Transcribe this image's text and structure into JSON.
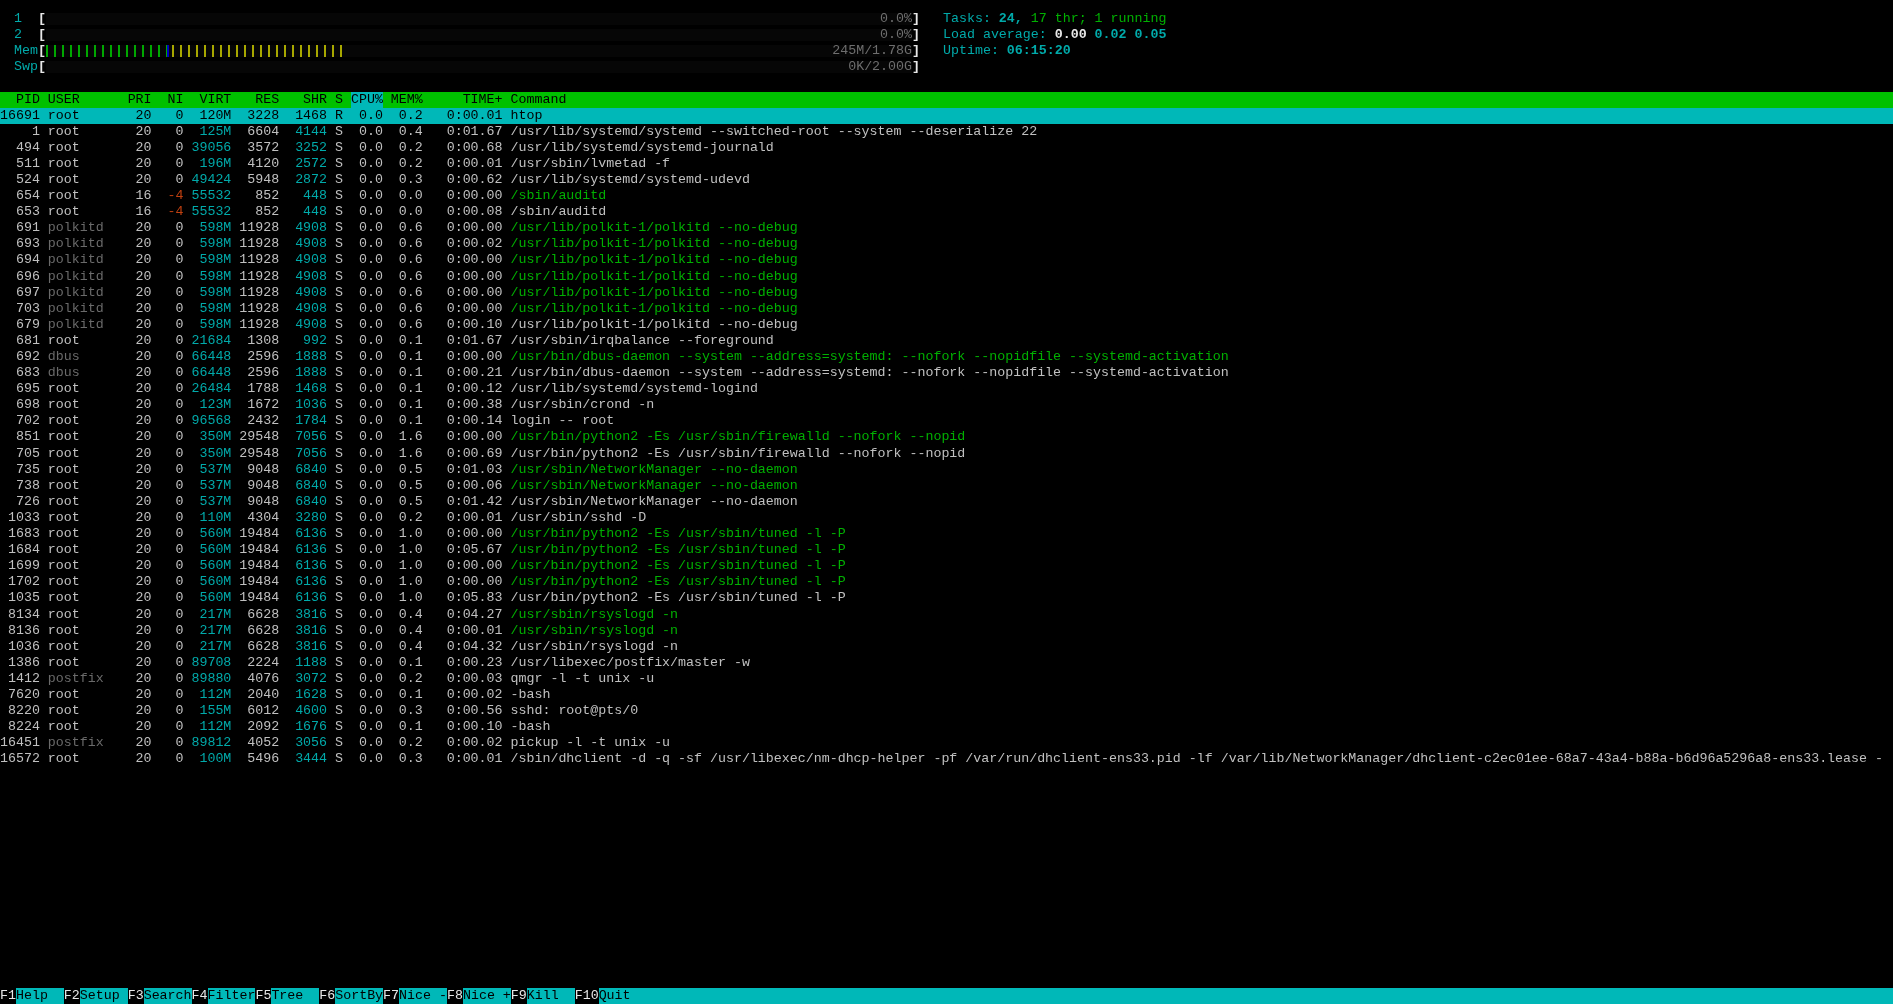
{
  "meters": [
    {
      "label": "1",
      "open": "[",
      "reading": "0.0%",
      "close": "]"
    },
    {
      "label": "2",
      "open": "[",
      "reading": "0.0%",
      "close": "]"
    },
    {
      "label": "Mem",
      "open": "[",
      "segments": [
        {
          "kind": "used",
          "level": 0.14
        },
        {
          "kind": "buffers",
          "level": 0.006
        },
        {
          "kind": "cache",
          "level": 0.2
        }
      ],
      "reading": "245M/1.78G",
      "close": "]"
    },
    {
      "label": "Swp",
      "open": "[",
      "reading": "0K/2.00G",
      "close": "]"
    }
  ],
  "summary": [
    [
      {
        "kind": "label",
        "text": "Tasks:"
      },
      {
        "kind": "value",
        "text": "24,"
      },
      {
        "kind": "thread",
        "text": "17"
      },
      {
        "kind": "thread",
        "text": "thr;"
      },
      {
        "kind": "thread",
        "text": "1"
      },
      {
        "kind": "thread",
        "text": "running"
      }
    ],
    [
      {
        "kind": "label",
        "text": "Load average:"
      },
      {
        "kind": "bright",
        "text": "0.00"
      },
      {
        "kind": "value",
        "text": "0.02"
      },
      {
        "kind": "value",
        "text": "0.05"
      }
    ],
    [
      {
        "kind": "label",
        "text": "Uptime:"
      },
      {
        "kind": "value",
        "text": "06:15:20"
      }
    ]
  ],
  "columns": [
    {
      "label": "PID",
      "sorted": false
    },
    {
      "label": "USER",
      "sorted": false
    },
    {
      "label": "PRI",
      "sorted": false
    },
    {
      "label": "NI",
      "sorted": false
    },
    {
      "label": "VIRT",
      "sorted": false
    },
    {
      "label": "RES",
      "sorted": false
    },
    {
      "label": "SHR",
      "sorted": false
    },
    {
      "label": "S",
      "sorted": false
    },
    {
      "label": "CPU%",
      "sorted": true
    },
    {
      "label": "MEM%",
      "sorted": false
    },
    {
      "label": "TIME+",
      "sorted": false
    },
    {
      "label": "Command",
      "sorted": false
    }
  ],
  "rows": [
    {
      "cells": [
        "16691",
        "root",
        "20",
        "0",
        "120M",
        "3228",
        "1468",
        "R",
        "0.0",
        "0.2",
        "0:00.01",
        "htop"
      ],
      "selected": true
    },
    {
      "cells": [
        "1",
        "root",
        "20",
        "0",
        "125M",
        "6604",
        "4144",
        "S",
        "0.0",
        "0.4",
        "0:01.67",
        "/usr/lib/systemd/systemd --switched-root --system --deserialize 22"
      ],
      "selected": false,
      "thread": false,
      "system_user": false,
      "niced": false
    },
    {
      "cells": [
        "494",
        "root",
        "20",
        "0",
        "39056",
        "3572",
        "3252",
        "S",
        "0.0",
        "0.2",
        "0:00.68",
        "/usr/lib/systemd/systemd-journald"
      ],
      "selected": false,
      "thread": false,
      "system_user": false,
      "niced": false
    },
    {
      "cells": [
        "511",
        "root",
        "20",
        "0",
        "196M",
        "4120",
        "2572",
        "S",
        "0.0",
        "0.2",
        "0:00.01",
        "/usr/sbin/lvmetad -f"
      ],
      "selected": false,
      "thread": false,
      "system_user": false,
      "niced": false
    },
    {
      "cells": [
        "524",
        "root",
        "20",
        "0",
        "49424",
        "5948",
        "2872",
        "S",
        "0.0",
        "0.3",
        "0:00.62",
        "/usr/lib/systemd/systemd-udevd"
      ],
      "selected": false,
      "thread": false,
      "system_user": false,
      "niced": false
    },
    {
      "cells": [
        "654",
        "root",
        "16",
        "-4",
        "55532",
        "852",
        "448",
        "S",
        "0.0",
        "0.0",
        "0:00.00",
        "/sbin/auditd"
      ],
      "selected": false,
      "thread": true,
      "system_user": false,
      "niced": true
    },
    {
      "cells": [
        "653",
        "root",
        "16",
        "-4",
        "55532",
        "852",
        "448",
        "S",
        "0.0",
        "0.0",
        "0:00.08",
        "/sbin/auditd"
      ],
      "selected": false,
      "thread": false,
      "system_user": false,
      "niced": true
    },
    {
      "cells": [
        "691",
        "polkitd",
        "20",
        "0",
        "598M",
        "11928",
        "4908",
        "S",
        "0.0",
        "0.6",
        "0:00.00",
        "/usr/lib/polkit-1/polkitd --no-debug"
      ],
      "selected": false,
      "thread": true,
      "system_user": true,
      "niced": false
    },
    {
      "cells": [
        "693",
        "polkitd",
        "20",
        "0",
        "598M",
        "11928",
        "4908",
        "S",
        "0.0",
        "0.6",
        "0:00.02",
        "/usr/lib/polkit-1/polkitd --no-debug"
      ],
      "selected": false,
      "thread": true,
      "system_user": true,
      "niced": false
    },
    {
      "cells": [
        "694",
        "polkitd",
        "20",
        "0",
        "598M",
        "11928",
        "4908",
        "S",
        "0.0",
        "0.6",
        "0:00.00",
        "/usr/lib/polkit-1/polkitd --no-debug"
      ],
      "selected": false,
      "thread": true,
      "system_user": true,
      "niced": false
    },
    {
      "cells": [
        "696",
        "polkitd",
        "20",
        "0",
        "598M",
        "11928",
        "4908",
        "S",
        "0.0",
        "0.6",
        "0:00.00",
        "/usr/lib/polkit-1/polkitd --no-debug"
      ],
      "selected": false,
      "thread": true,
      "system_user": true,
      "niced": false
    },
    {
      "cells": [
        "697",
        "polkitd",
        "20",
        "0",
        "598M",
        "11928",
        "4908",
        "S",
        "0.0",
        "0.6",
        "0:00.00",
        "/usr/lib/polkit-1/polkitd --no-debug"
      ],
      "selected": false,
      "thread": true,
      "system_user": true,
      "niced": false
    },
    {
      "cells": [
        "703",
        "polkitd",
        "20",
        "0",
        "598M",
        "11928",
        "4908",
        "S",
        "0.0",
        "0.6",
        "0:00.00",
        "/usr/lib/polkit-1/polkitd --no-debug"
      ],
      "selected": false,
      "thread": true,
      "system_user": true,
      "niced": false
    },
    {
      "cells": [
        "679",
        "polkitd",
        "20",
        "0",
        "598M",
        "11928",
        "4908",
        "S",
        "0.0",
        "0.6",
        "0:00.10",
        "/usr/lib/polkit-1/polkitd --no-debug"
      ],
      "selected": false,
      "thread": false,
      "system_user": true,
      "niced": false
    },
    {
      "cells": [
        "681",
        "root",
        "20",
        "0",
        "21684",
        "1308",
        "992",
        "S",
        "0.0",
        "0.1",
        "0:01.67",
        "/usr/sbin/irqbalance --foreground"
      ],
      "selected": false,
      "thread": false,
      "system_user": false,
      "niced": false
    },
    {
      "cells": [
        "692",
        "dbus",
        "20",
        "0",
        "66448",
        "2596",
        "1888",
        "S",
        "0.0",
        "0.1",
        "0:00.00",
        "/usr/bin/dbus-daemon --system --address=systemd: --nofork --nopidfile --systemd-activation"
      ],
      "selected": false,
      "thread": true,
      "system_user": true,
      "niced": false
    },
    {
      "cells": [
        "683",
        "dbus",
        "20",
        "0",
        "66448",
        "2596",
        "1888",
        "S",
        "0.0",
        "0.1",
        "0:00.21",
        "/usr/bin/dbus-daemon --system --address=systemd: --nofork --nopidfile --systemd-activation"
      ],
      "selected": false,
      "thread": false,
      "system_user": true,
      "niced": false
    },
    {
      "cells": [
        "695",
        "root",
        "20",
        "0",
        "26484",
        "1788",
        "1468",
        "S",
        "0.0",
        "0.1",
        "0:00.12",
        "/usr/lib/systemd/systemd-logind"
      ],
      "selected": false,
      "thread": false,
      "system_user": false,
      "niced": false
    },
    {
      "cells": [
        "698",
        "root",
        "20",
        "0",
        "123M",
        "1672",
        "1036",
        "S",
        "0.0",
        "0.1",
        "0:00.38",
        "/usr/sbin/crond -n"
      ],
      "selected": false,
      "thread": false,
      "system_user": false,
      "niced": false
    },
    {
      "cells": [
        "702",
        "root",
        "20",
        "0",
        "96568",
        "2432",
        "1784",
        "S",
        "0.0",
        "0.1",
        "0:00.14",
        "login -- root"
      ],
      "selected": false,
      "thread": false,
      "system_user": false,
      "niced": false
    },
    {
      "cells": [
        "851",
        "root",
        "20",
        "0",
        "350M",
        "29548",
        "7056",
        "S",
        "0.0",
        "1.6",
        "0:00.00",
        "/usr/bin/python2 -Es /usr/sbin/firewalld --nofork --nopid"
      ],
      "selected": false,
      "thread": true,
      "system_user": false,
      "niced": false
    },
    {
      "cells": [
        "705",
        "root",
        "20",
        "0",
        "350M",
        "29548",
        "7056",
        "S",
        "0.0",
        "1.6",
        "0:00.69",
        "/usr/bin/python2 -Es /usr/sbin/firewalld --nofork --nopid"
      ],
      "selected": false,
      "thread": false,
      "system_user": false,
      "niced": false
    },
    {
      "cells": [
        "735",
        "root",
        "20",
        "0",
        "537M",
        "9048",
        "6840",
        "S",
        "0.0",
        "0.5",
        "0:01.03",
        "/usr/sbin/NetworkManager --no-daemon"
      ],
      "selected": false,
      "thread": true,
      "system_user": false,
      "niced": false
    },
    {
      "cells": [
        "738",
        "root",
        "20",
        "0",
        "537M",
        "9048",
        "6840",
        "S",
        "0.0",
        "0.5",
        "0:00.06",
        "/usr/sbin/NetworkManager --no-daemon"
      ],
      "selected": false,
      "thread": true,
      "system_user": false,
      "niced": false
    },
    {
      "cells": [
        "726",
        "root",
        "20",
        "0",
        "537M",
        "9048",
        "6840",
        "S",
        "0.0",
        "0.5",
        "0:01.42",
        "/usr/sbin/NetworkManager --no-daemon"
      ],
      "selected": false,
      "thread": false,
      "system_user": false,
      "niced": false
    },
    {
      "cells": [
        "1033",
        "root",
        "20",
        "0",
        "110M",
        "4304",
        "3280",
        "S",
        "0.0",
        "0.2",
        "0:00.01",
        "/usr/sbin/sshd -D"
      ],
      "selected": false,
      "thread": false,
      "system_user": false,
      "niced": false
    },
    {
      "cells": [
        "1683",
        "root",
        "20",
        "0",
        "560M",
        "19484",
        "6136",
        "S",
        "0.0",
        "1.0",
        "0:00.00",
        "/usr/bin/python2 -Es /usr/sbin/tuned -l -P"
      ],
      "selected": false,
      "thread": true,
      "system_user": false,
      "niced": false
    },
    {
      "cells": [
        "1684",
        "root",
        "20",
        "0",
        "560M",
        "19484",
        "6136",
        "S",
        "0.0",
        "1.0",
        "0:05.67",
        "/usr/bin/python2 -Es /usr/sbin/tuned -l -P"
      ],
      "selected": false,
      "thread": true,
      "system_user": false,
      "niced": false
    },
    {
      "cells": [
        "1699",
        "root",
        "20",
        "0",
        "560M",
        "19484",
        "6136",
        "S",
        "0.0",
        "1.0",
        "0:00.00",
        "/usr/bin/python2 -Es /usr/sbin/tuned -l -P"
      ],
      "selected": false,
      "thread": true,
      "system_user": false,
      "niced": false
    },
    {
      "cells": [
        "1702",
        "root",
        "20",
        "0",
        "560M",
        "19484",
        "6136",
        "S",
        "0.0",
        "1.0",
        "0:00.00",
        "/usr/bin/python2 -Es /usr/sbin/tuned -l -P"
      ],
      "selected": false,
      "thread": true,
      "system_user": false,
      "niced": false
    },
    {
      "cells": [
        "1035",
        "root",
        "20",
        "0",
        "560M",
        "19484",
        "6136",
        "S",
        "0.0",
        "1.0",
        "0:05.83",
        "/usr/bin/python2 -Es /usr/sbin/tuned -l -P"
      ],
      "selected": false,
      "thread": false,
      "system_user": false,
      "niced": false
    },
    {
      "cells": [
        "8134",
        "root",
        "20",
        "0",
        "217M",
        "6628",
        "3816",
        "S",
        "0.0",
        "0.4",
        "0:04.27",
        "/usr/sbin/rsyslogd -n"
      ],
      "selected": false,
      "thread": true,
      "system_user": false,
      "niced": false
    },
    {
      "cells": [
        "8136",
        "root",
        "20",
        "0",
        "217M",
        "6628",
        "3816",
        "S",
        "0.0",
        "0.4",
        "0:00.01",
        "/usr/sbin/rsyslogd -n"
      ],
      "selected": false,
      "thread": true,
      "system_user": false,
      "niced": false
    },
    {
      "cells": [
        "1036",
        "root",
        "20",
        "0",
        "217M",
        "6628",
        "3816",
        "S",
        "0.0",
        "0.4",
        "0:04.32",
        "/usr/sbin/rsyslogd -n"
      ],
      "selected": false,
      "thread": false,
      "system_user": false,
      "niced": false
    },
    {
      "cells": [
        "1386",
        "root",
        "20",
        "0",
        "89708",
        "2224",
        "1188",
        "S",
        "0.0",
        "0.1",
        "0:00.23",
        "/usr/libexec/postfix/master -w"
      ],
      "selected": false,
      "thread": false,
      "system_user": false,
      "niced": false
    },
    {
      "cells": [
        "1412",
        "postfix",
        "20",
        "0",
        "89880",
        "4076",
        "3072",
        "S",
        "0.0",
        "0.2",
        "0:00.03",
        "qmgr -l -t unix -u"
      ],
      "selected": false,
      "thread": false,
      "system_user": true,
      "niced": false
    },
    {
      "cells": [
        "7620",
        "root",
        "20",
        "0",
        "112M",
        "2040",
        "1628",
        "S",
        "0.0",
        "0.1",
        "0:00.02",
        "-bash"
      ],
      "selected": false,
      "thread": false,
      "system_user": false,
      "niced": false
    },
    {
      "cells": [
        "8220",
        "root",
        "20",
        "0",
        "155M",
        "6012",
        "4600",
        "S",
        "0.0",
        "0.3",
        "0:00.56",
        "sshd: root@pts/0"
      ],
      "selected": false,
      "thread": false,
      "system_user": false,
      "niced": false
    },
    {
      "cells": [
        "8224",
        "root",
        "20",
        "0",
        "112M",
        "2092",
        "1676",
        "S",
        "0.0",
        "0.1",
        "0:00.10",
        "-bash"
      ],
      "selected": false,
      "thread": false,
      "system_user": false,
      "niced": false
    },
    {
      "cells": [
        "16451",
        "postfix",
        "20",
        "0",
        "89812",
        "4052",
        "3056",
        "S",
        "0.0",
        "0.2",
        "0:00.02",
        "pickup -l -t unix -u"
      ],
      "selected": false,
      "thread": false,
      "system_user": true,
      "niced": false
    },
    {
      "cells": [
        "16572",
        "root",
        "20",
        "0",
        "100M",
        "5496",
        "3444",
        "S",
        "0.0",
        "0.3",
        "0:00.01",
        "/sbin/dhclient -d -q -sf /usr/libexec/nm-dhcp-helper -pf /var/run/dhclient-ens33.pid -lf /var/lib/NetworkManager/dhclient-c2ec01ee-68a7-43a4-b88a-b6d96a5296a8-ens33.lease -"
      ],
      "selected": false,
      "thread": false,
      "system_user": false,
      "niced": false
    }
  ],
  "function_keys": [
    {
      "key": "F1",
      "label": "Help"
    },
    {
      "key": "F2",
      "label": "Setup"
    },
    {
      "key": "F3",
      "label": "Search"
    },
    {
      "key": "F4",
      "label": "Filter"
    },
    {
      "key": "F5",
      "label": "Tree"
    },
    {
      "key": "F6",
      "label": "SortBy"
    },
    {
      "key": "F7",
      "label": "Nice -"
    },
    {
      "key": "F8",
      "label": "Nice +"
    },
    {
      "key": "F9",
      "label": "Kill"
    },
    {
      "key": "F10",
      "label": "Quit"
    }
  ]
}
